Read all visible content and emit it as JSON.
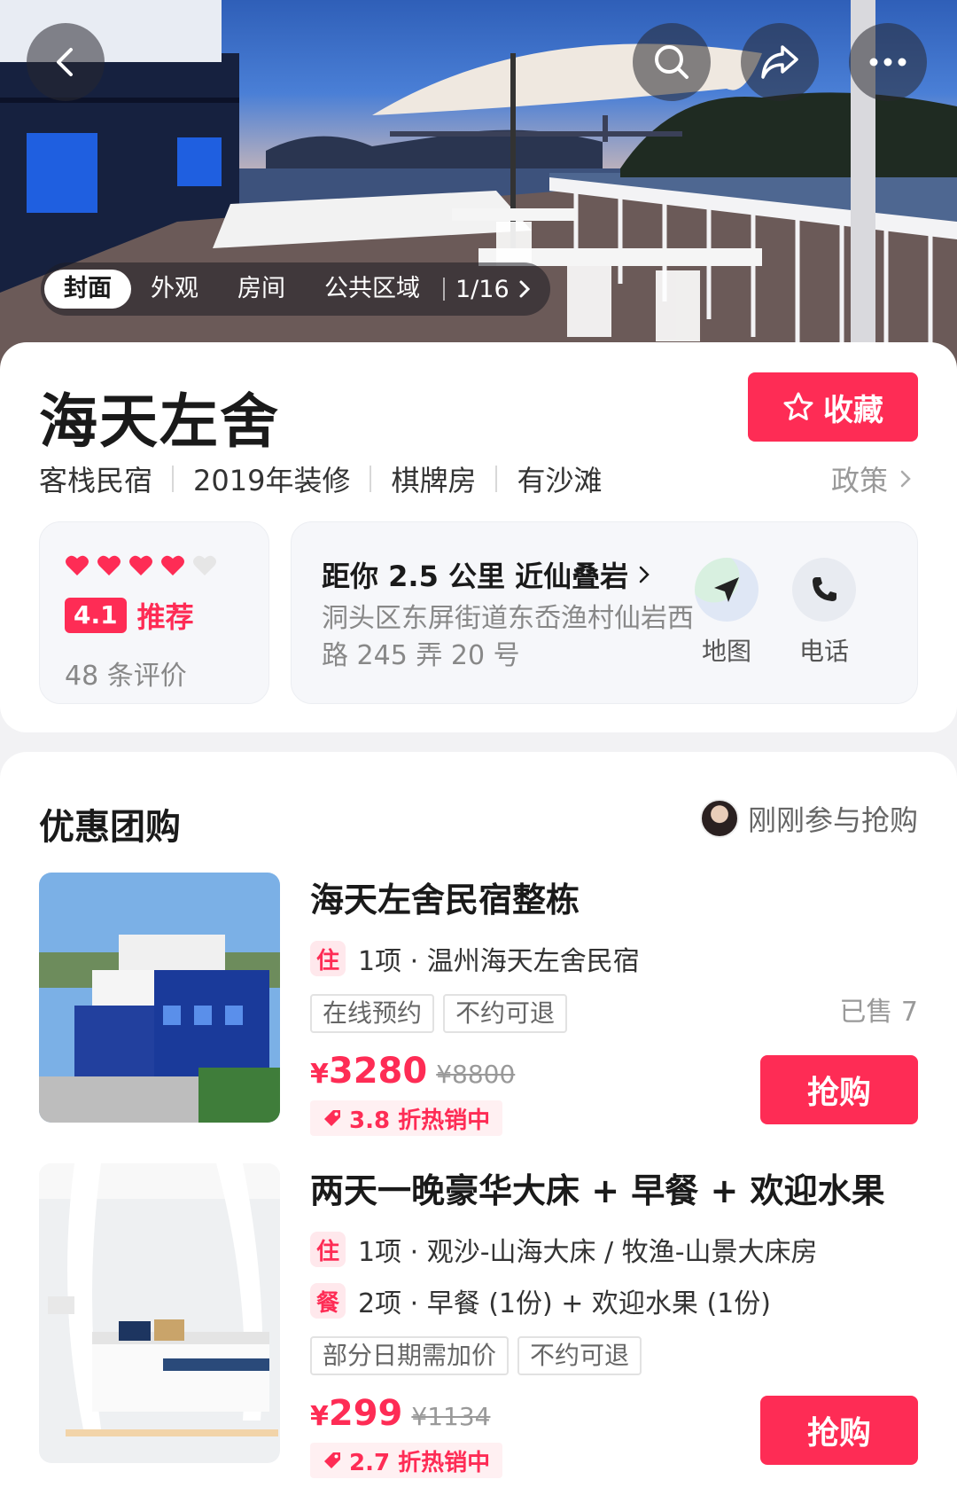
{
  "hero": {
    "album_tabs": [
      "封面",
      "外观",
      "房间",
      "公共区域"
    ],
    "active_tab": "封面",
    "photo_counter": "1/16"
  },
  "hotel": {
    "name": "海天左舍",
    "favorite_label": "收藏",
    "tags": [
      "客栈民宿",
      "2019年装修",
      "棋牌房",
      "有沙滩"
    ],
    "policy_label": "政策"
  },
  "rating": {
    "hearts_filled": 4,
    "hearts_total": 5,
    "score": "4.1",
    "score_text": "推荐",
    "review_count": "48 条评价"
  },
  "location": {
    "distance": "距你 2.5 公里 近仙叠岩",
    "address": "洞头区东屏街道东岙渔村仙岩西路 245 弄 20 号",
    "map_label": "地图",
    "phone_label": "电话"
  },
  "deals": {
    "section_title": "优惠团购",
    "joined_text": "刚刚参与抢购",
    "items": [
      {
        "title": "海天左舍民宿整栋",
        "lines": [
          {
            "badge": "住",
            "text": "1项 · 温州海天左舍民宿"
          }
        ],
        "conditions": [
          "在线预约",
          "不约可退"
        ],
        "sold": "已售 7",
        "price_symbol": "¥",
        "price": "3280",
        "original_price": "¥8800",
        "discount": "3.8 折热销中",
        "buy_label": "抢购"
      },
      {
        "title": "两天一晚豪华大床 + 早餐 + 欢迎水果",
        "lines": [
          {
            "badge": "住",
            "text": "1项 · 观沙-山海大床 / 牧渔-山景大床房"
          },
          {
            "badge": "餐",
            "text": "2项 · 早餐 (1份) + 欢迎水果 (1份)"
          }
        ],
        "conditions": [
          "部分日期需加价",
          "不约可退"
        ],
        "price_symbol": "¥",
        "price": "299",
        "original_price": "¥1134",
        "discount": "2.7 折热销中",
        "buy_label": "抢购"
      }
    ]
  },
  "colors": {
    "accent": "#fe2c55",
    "heart_empty": "#e6e6e6"
  }
}
